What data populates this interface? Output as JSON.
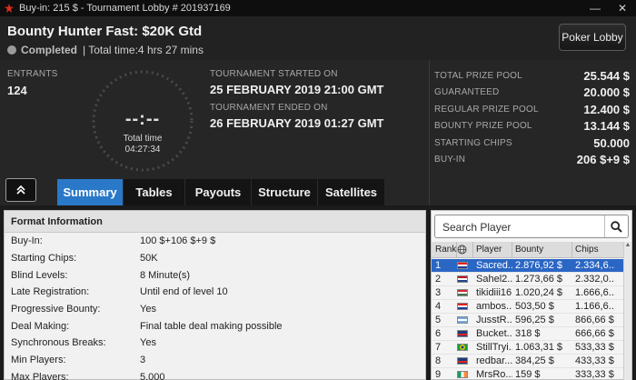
{
  "window": {
    "title": "Buy-in: 215 $ - Tournament Lobby # 201937169",
    "minimize": "—",
    "close": "✕"
  },
  "header": {
    "name": "Bounty Hunter Fast: $20K Gtd",
    "status": "Completed",
    "total_time": "| Total time:4 hrs  27 mins",
    "poker_lobby_label": "Poker Lobby"
  },
  "info": {
    "entrants_label": "ENTRANTS",
    "entrants_value": "124",
    "clock_digits": "--:--",
    "clock_label": "Total time",
    "clock_value": "04:27:34",
    "started_label": "TOURNAMENT STARTED ON",
    "started_value": "25 FEBRUARY 2019  21:00 GMT",
    "ended_label": "TOURNAMENT ENDED ON",
    "ended_value": "26 FEBRUARY 2019  01:27 GMT"
  },
  "prize": [
    {
      "label": "TOTAL PRIZE POOL",
      "value": "25.544 $"
    },
    {
      "label": "GUARANTEED",
      "value": "20.000 $"
    },
    {
      "label": "REGULAR PRIZE POOL",
      "value": "12.400 $"
    },
    {
      "label": "BOUNTY PRIZE POOL",
      "value": "13.144 $"
    },
    {
      "label": "STARTING CHIPS",
      "value": "50.000"
    },
    {
      "label": "BUY-IN",
      "value": "206 $+9 $"
    }
  ],
  "tabs": [
    {
      "label": "Summary",
      "active": true
    },
    {
      "label": "Tables",
      "active": false
    },
    {
      "label": "Payouts",
      "active": false
    },
    {
      "label": "Structure",
      "active": false
    },
    {
      "label": "Satellites",
      "active": false
    }
  ],
  "format": {
    "title": "Format Information",
    "rows": [
      {
        "key": "Buy-In:",
        "value": "100 $+106 $+9 $"
      },
      {
        "key": "Starting Chips:",
        "value": "50K"
      },
      {
        "key": "Blind Levels:",
        "value": "8 Minute(s)"
      },
      {
        "key": "Late Registration:",
        "value": "Until end of level 10"
      },
      {
        "key": "Progressive Bounty:",
        "value": "Yes"
      },
      {
        "key": "Deal Making:",
        "value": "Final table deal making possible"
      },
      {
        "key": "Synchronous Breaks:",
        "value": "Yes"
      },
      {
        "key": "Min Players:",
        "value": "3"
      },
      {
        "key": "Max Players:",
        "value": "5.000"
      }
    ]
  },
  "players": {
    "search_placeholder": "Search Player",
    "columns": {
      "rank": "Rank",
      "player": "Player",
      "bounty": "Bounty",
      "chips": "Chips"
    },
    "rows": [
      {
        "rank": "1",
        "flag": "hr",
        "player": "Sacred...",
        "bounty": "2.876,92 $",
        "chips": "2.334,6..."
      },
      {
        "rank": "2",
        "flag": "nl",
        "player": "Sahel2...",
        "bounty": "1.273,66 $",
        "chips": "2.332,0..."
      },
      {
        "rank": "3",
        "flag": "hu",
        "player": "tikidiii16",
        "bounty": "1.020,24 $",
        "chips": "1.666,6..."
      },
      {
        "rank": "4",
        "flag": "hr",
        "player": "ambos...",
        "bounty": "503,50 $",
        "chips": "1.166,6..."
      },
      {
        "rank": "5",
        "flag": "ar",
        "player": "JusstR...",
        "bounty": "596,25 $",
        "chips": "866,66 $"
      },
      {
        "rank": "6",
        "flag": "gb",
        "player": "Bucket...",
        "bounty": "318 $",
        "chips": "666,66 $"
      },
      {
        "rank": "7",
        "flag": "br",
        "player": "StillTryi...",
        "bounty": "1.063,31 $",
        "chips": "533,33 $"
      },
      {
        "rank": "8",
        "flag": "gb",
        "player": "redbar...",
        "bounty": "384,25 $",
        "chips": "433,33 $"
      },
      {
        "rank": "9",
        "flag": "ie",
        "player": "MrsRo...",
        "bounty": "159 $",
        "chips": "333,33 $"
      }
    ]
  },
  "colors": {
    "accent": "#2a78c8",
    "selected_row": "#2a66c4",
    "background": "#1b1b1b"
  }
}
